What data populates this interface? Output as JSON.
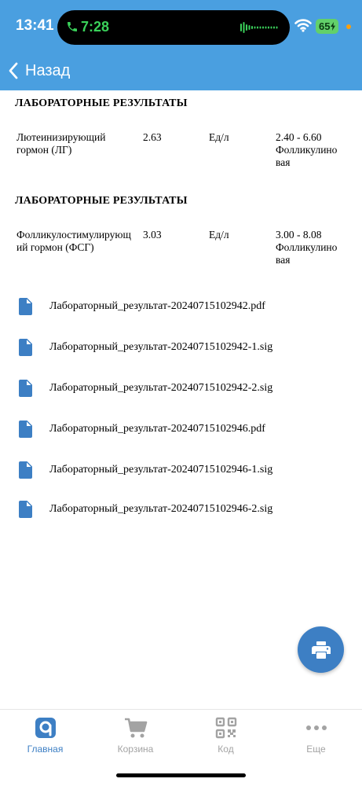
{
  "status_bar": {
    "time": "13:41",
    "call_time": "7:28",
    "battery": "65"
  },
  "nav": {
    "back_label": "Назад"
  },
  "lab_sections": [
    {
      "title": "ЛАБОРАТОРНЫЕ РЕЗУЛЬТАТЫ",
      "name_lines": [
        "Лютеинизирующий",
        "гормон (ЛГ)"
      ],
      "value": "2.63",
      "unit": "Ед/л",
      "range_lines": [
        "2.40 - 6.60",
        "Фолликулино",
        "вая"
      ]
    },
    {
      "title": "ЛАБОРАТОРНЫЕ РЕЗУЛЬТАТЫ",
      "name_lines": [
        "Фолликулостимулирующ",
        "ий гормон (ФСГ)"
      ],
      "value": "3.03",
      "unit": "Ед/л",
      "range_lines": [
        "3.00 - 8.08",
        "Фолликулино",
        "вая"
      ]
    }
  ],
  "files": [
    "Лабораторный_результат-20240715102942.pdf",
    "Лабораторный_результат-20240715102942-1.sig",
    "Лабораторный_результат-20240715102942-2.sig",
    "Лабораторный_результат-20240715102946.pdf",
    "Лабораторный_результат-20240715102946-1.sig",
    "Лабораторный_результат-20240715102946-2.sig"
  ],
  "fab": {
    "icon": "printer-icon"
  },
  "tabbar": {
    "tabs": [
      {
        "label": "Главная",
        "icon": "home-logo-icon",
        "active": true
      },
      {
        "label": "Корзина",
        "icon": "cart-icon",
        "active": false
      },
      {
        "label": "Код",
        "icon": "qr-code-icon",
        "active": false
      },
      {
        "label": "Еще",
        "icon": "more-dots-icon",
        "active": false
      }
    ]
  },
  "colors": {
    "header": "#4a9fe0",
    "accent": "#3d7fc4",
    "tab_inactive": "#a3a3a3"
  }
}
